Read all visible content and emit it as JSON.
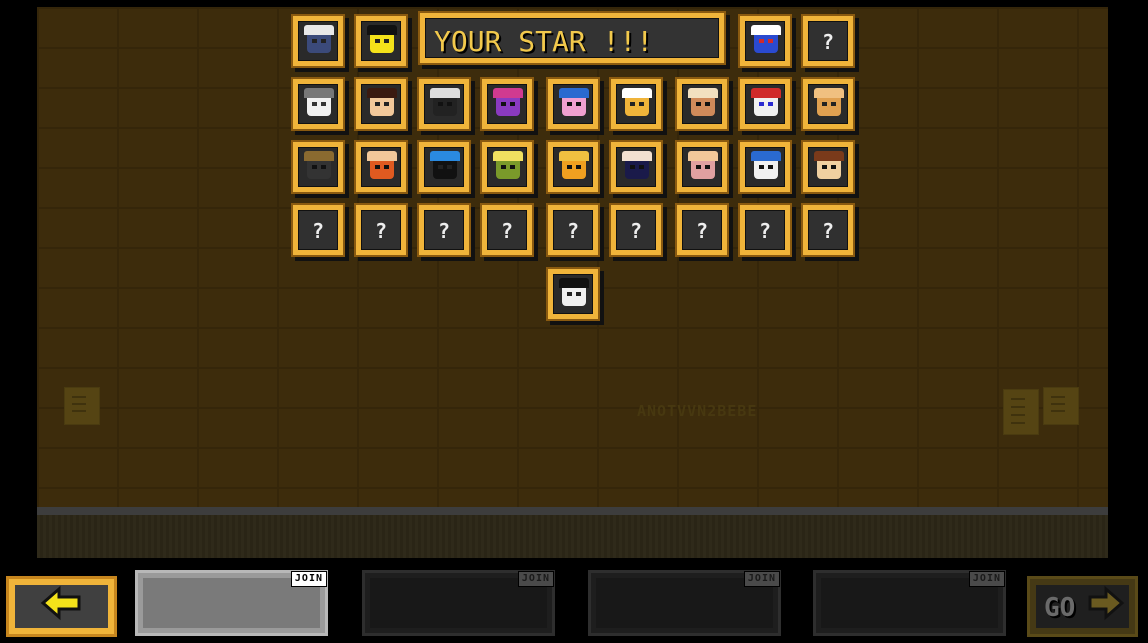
{
  "banner": {
    "text": "YOUR STAR !!!"
  },
  "wall": {
    "sign_text": "ANOTVVN2BEBE"
  },
  "grid": {
    "row1_left": [
      {
        "name": "character-ninja-cap",
        "colors": [
          "#3b4a7a",
          "#e8e8e8",
          "#222"
        ]
      },
      {
        "name": "character-yellow-blob",
        "colors": [
          "#f4e21a",
          "#111",
          "#222"
        ]
      }
    ],
    "row1_right": [
      {
        "name": "character-blue-bird",
        "colors": [
          "#2a4ad0",
          "#ffffff",
          "#d02a2a"
        ]
      },
      {
        "name": "unknown",
        "symbol": "?"
      }
    ],
    "row2": [
      {
        "name": "character-white-rabbit",
        "colors": [
          "#f0f0f0",
          "#777",
          "#333"
        ]
      },
      {
        "name": "character-dark-hair-girl",
        "colors": [
          "#f2c89a",
          "#3a1a10",
          "#222"
        ]
      },
      {
        "name": "character-black-cat",
        "colors": [
          "#222",
          "#ddd",
          "#111"
        ]
      },
      {
        "name": "character-purple-spiky",
        "colors": [
          "#8a3ac0",
          "#d03a90",
          "#111"
        ]
      },
      {
        "name": "character-pink-goggles",
        "colors": [
          "#f0a0d0",
          "#2a6ad0",
          "#111"
        ]
      },
      {
        "name": "character-orange-glasses",
        "colors": [
          "#f0b43a",
          "#ffffff",
          "#222"
        ]
      },
      {
        "name": "character-brown-hamster",
        "colors": [
          "#d08a5a",
          "#f2e0c0",
          "#111"
        ]
      },
      {
        "name": "character-clown",
        "colors": [
          "#f0f0f0",
          "#d02a2a",
          "#2a2ad0"
        ]
      },
      {
        "name": "character-tan-rabbit",
        "colors": [
          "#e0a050",
          "#f0c080",
          "#222"
        ]
      }
    ],
    "row3": [
      {
        "name": "character-masked-ninja",
        "colors": [
          "#333",
          "#8a6a30",
          "#111"
        ]
      },
      {
        "name": "character-red-hair-glasses",
        "colors": [
          "#e05a20",
          "#f2c89a",
          "#111"
        ]
      },
      {
        "name": "character-blue-robot",
        "colors": [
          "#111",
          "#2a8ae0",
          "#222"
        ]
      },
      {
        "name": "character-green-frog",
        "colors": [
          "#7a9a2a",
          "#f0e060",
          "#111"
        ]
      },
      {
        "name": "character-orange-smile",
        "colors": [
          "#f0a020",
          "#f0c040",
          "#111"
        ]
      },
      {
        "name": "character-navy-hair",
        "colors": [
          "#1a1a4a",
          "#f2e0d0",
          "#111"
        ]
      },
      {
        "name": "character-pink-pig",
        "colors": [
          "#e0a0a0",
          "#f2c89a",
          "#111"
        ]
      },
      {
        "name": "character-white-owl",
        "colors": [
          "#f0f0f0",
          "#2a6ad0",
          "#111"
        ]
      },
      {
        "name": "character-bandana",
        "colors": [
          "#f0d0a0",
          "#7a3a1a",
          "#111"
        ]
      }
    ],
    "row4": [
      {
        "name": "unknown",
        "symbol": "?"
      },
      {
        "name": "unknown",
        "symbol": "?"
      },
      {
        "name": "unknown",
        "symbol": "?"
      },
      {
        "name": "unknown",
        "symbol": "?"
      },
      {
        "name": "unknown",
        "symbol": "?"
      },
      {
        "name": "unknown",
        "symbol": "?"
      },
      {
        "name": "unknown",
        "symbol": "?"
      },
      {
        "name": "unknown",
        "symbol": "?"
      },
      {
        "name": "unknown",
        "symbol": "?"
      }
    ],
    "row5": [
      {
        "name": "character-panda-ghost",
        "colors": [
          "#f0f0f0",
          "#111",
          "#222"
        ]
      }
    ]
  },
  "controls": {
    "back_icon": "arrow-left-icon",
    "go_label": "GO",
    "go_icon": "arrow-right-icon"
  },
  "players": [
    {
      "join_label": "JOIN",
      "state": "active"
    },
    {
      "join_label": "JOIN",
      "state": "inactive"
    },
    {
      "join_label": "JOIN",
      "state": "inactive"
    },
    {
      "join_label": "JOIN",
      "state": "inactive"
    }
  ],
  "colors": {
    "frame": "#f0b43a",
    "banner_text": "#f2c94c",
    "wall": "#3d2c0c"
  }
}
